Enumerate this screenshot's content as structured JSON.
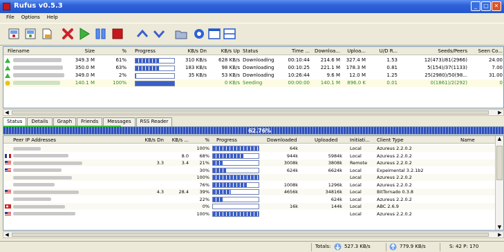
{
  "window": {
    "title": "Rufus v0.5.3",
    "buttons": [
      "_",
      "□",
      "✕"
    ]
  },
  "menu": [
    "File",
    "Options",
    "Help"
  ],
  "toolbar": {
    "icons": [
      "new-torrent",
      "open-torrent",
      "open-url",
      "remove",
      "start",
      "pause",
      "stop",
      "move-up",
      "move-down",
      "open-folder",
      "settings",
      "layout-1",
      "layout-2"
    ]
  },
  "torrents": {
    "columns": [
      "Filename",
      "Size",
      "%",
      "Progress",
      "KB/s Dn",
      "KB/s Up",
      "Status",
      "Time ...",
      "Downloa...",
      "Uploa...",
      "U/D R...",
      "Seeds/Peers",
      "Seen Co..."
    ],
    "rows": [
      {
        "size": "349.3 M",
        "pct": "61%",
        "progress": 0.61,
        "dn": "310 KB/s",
        "up": "628 KB/s",
        "status": "Downloading",
        "time": "00:10:44",
        "downloaded": "214.6 M",
        "uploaded": "327.4 M",
        "ratio": "1.53",
        "seeds": "12(473)/81(2966)",
        "seen": "24.00",
        "state": "downloading"
      },
      {
        "size": "350.0 M",
        "pct": "63%",
        "progress": 0.63,
        "dn": "183 KB/s",
        "up": "98 KB/s",
        "status": "Downloading",
        "time": "00:10:25",
        "downloaded": "221.1 M",
        "uploaded": "178.3 M",
        "ratio": "0.81",
        "seeds": "5(154)/37(1133)",
        "seen": "7.00",
        "state": "downloading"
      },
      {
        "size": "349.0 M",
        "pct": "2%",
        "progress": 0.02,
        "dn": "35 KB/s",
        "up": "53 KB/s",
        "status": "Downloading",
        "time": "10:26:44",
        "downloaded": "9.6 M",
        "uploaded": "12.0 M",
        "ratio": "1.25",
        "seeds": "25(2980)/50(98...",
        "seen": "31.00",
        "state": "downloading"
      },
      {
        "size": "140.1 M",
        "pct": "100%",
        "progress": 1.0,
        "dn": "",
        "up": "0 KB/s",
        "status": "Seeding",
        "time": "00:00:00",
        "downloaded": "140.1 M",
        "uploaded": "896.0 K",
        "ratio": "0.01",
        "seeds": "0(1861)/2(292)",
        "seen": "0",
        "state": "seeding"
      }
    ]
  },
  "tabs": [
    "Status",
    "Details",
    "Graph",
    "Friends",
    "Messages",
    "RSS Reader"
  ],
  "availability": {
    "text": "62.76%"
  },
  "peers": {
    "columns": [
      "Peer IP Addresses",
      "KB/s Dn",
      "KB/s ...",
      "%",
      "Progress",
      "Downloaded",
      "Uploaded",
      "Initiati...",
      "Client Type",
      "Name"
    ],
    "rows": [
      {
        "dn": "",
        "up": "",
        "pct": "100%",
        "progress": 1.0,
        "downloaded": "64k",
        "uploaded": "",
        "init": "Local",
        "client": "Azureus 2.2.0.2",
        "flag": "none"
      },
      {
        "dn": "",
        "up": "8.0",
        "pct": "68%",
        "progress": 0.68,
        "downloaded": "944k",
        "uploaded": "5984k",
        "init": "Local",
        "client": "Azureus 2.2.0.2",
        "flag": "fr"
      },
      {
        "dn": "3.3",
        "up": "3.4",
        "pct": "21%",
        "progress": 0.21,
        "downloaded": "3008k",
        "uploaded": "3808k",
        "init": "Remote",
        "client": "Azureus 2.2.0.2",
        "flag": "us"
      },
      {
        "dn": "",
        "up": "",
        "pct": "30%",
        "progress": 0.3,
        "downloaded": "624k",
        "uploaded": "6624k",
        "init": "Local",
        "client": "Expeimental 3.2.1b2",
        "flag": "us"
      },
      {
        "dn": "",
        "up": "",
        "pct": "100%",
        "progress": 1.0,
        "downloaded": "",
        "uploaded": "",
        "init": "Local",
        "client": "Azureus 2.2.0.2",
        "flag": "none"
      },
      {
        "dn": "",
        "up": "",
        "pct": "76%",
        "progress": 0.76,
        "downloaded": "1008k",
        "uploaded": "1296k",
        "init": "Local",
        "client": "Azureus 2.2.0.2",
        "flag": "none"
      },
      {
        "dn": "4.3",
        "up": "28.4",
        "pct": "39%",
        "progress": 0.39,
        "downloaded": "4656k",
        "uploaded": "34816k",
        "init": "Local",
        "client": "BitTornado 0.3.8",
        "flag": "us"
      },
      {
        "dn": "",
        "up": "",
        "pct": "22%",
        "progress": 0.22,
        "downloaded": "",
        "uploaded": "624k",
        "init": "Local",
        "client": "Azureus 2.2.0.2",
        "flag": "none"
      },
      {
        "dn": "",
        "up": "",
        "pct": "0%",
        "progress": 0.0,
        "downloaded": "16k",
        "uploaded": "144k",
        "init": "Local",
        "client": "ABC 2.6.9",
        "flag": "tr"
      },
      {
        "dn": "",
        "up": "",
        "pct": "100%",
        "progress": 1.0,
        "downloaded": "",
        "uploaded": "",
        "init": "Local",
        "client": "Azureus 2.2.0.2",
        "flag": "us"
      }
    ]
  },
  "status": {
    "totals_label": "Totals:",
    "down_rate": "527.3 KB/s",
    "up_rate": "779.9 KB/s",
    "seeds_peers": "S: 42 P: 170"
  },
  "colors": {
    "progress": "#3a5fc8",
    "seeding": "#2c8a2c",
    "title": "#2357cc"
  }
}
